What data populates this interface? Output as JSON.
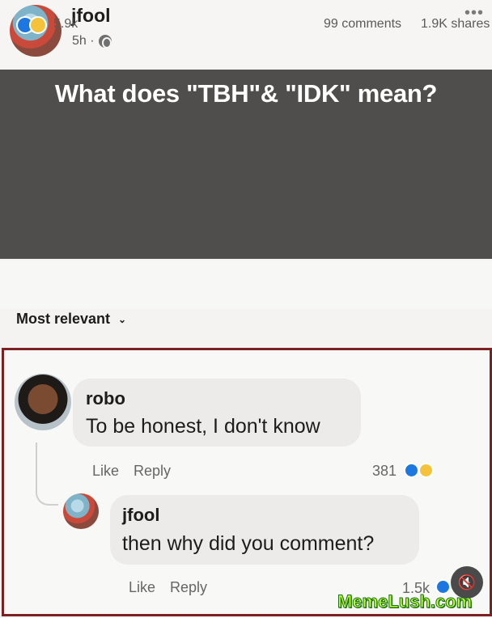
{
  "post": {
    "author": "jfool",
    "time": "5h ·",
    "globe_icon": "globe-icon",
    "more_icon": "more-icon",
    "text": "What does \"TBH\"& \"IDK\" mean?"
  },
  "stats": {
    "reactions": "5.9k",
    "comments": "99 comments",
    "shares": "1.9K shares"
  },
  "sort": {
    "label": "Most relevant"
  },
  "comments": [
    {
      "author": "robo",
      "text": "To be honest, I don't know",
      "actions": {
        "like": "Like",
        "reply": "Reply"
      },
      "reaction_count": "381"
    }
  ],
  "reply": {
    "author": "jfool",
    "text": "then why did you comment?",
    "actions": {
      "like": "Like",
      "reply": "Reply"
    },
    "reaction_count": "1.5k"
  },
  "watermark": "MemeLush.com",
  "colors": {
    "highlight_border": "#7c2022",
    "post_bg": "#4f4e4d",
    "like_blue": "#1c77e0",
    "haha_yellow": "#f5c33b"
  }
}
